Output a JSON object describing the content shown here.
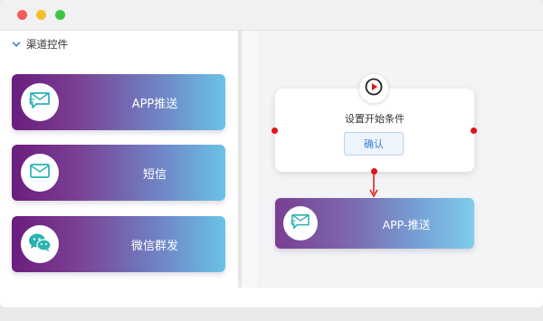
{
  "window": {
    "controls": [
      "close",
      "minimize",
      "zoom"
    ]
  },
  "sidebar": {
    "header": {
      "label": "渠道控件",
      "icon": "chevron-down-icon"
    },
    "items": [
      {
        "label": "APP推送",
        "icon": "message-send-icon"
      },
      {
        "label": "短信",
        "icon": "envelope-icon"
      },
      {
        "label": "微信群发",
        "icon": "wechat-icon"
      }
    ]
  },
  "canvas": {
    "start_node": {
      "icon": "play-icon",
      "title": "设置开始条件",
      "confirm_label": "确认"
    },
    "push_node": {
      "icon": "message-send-icon",
      "label": "APP-推送"
    }
  },
  "colors": {
    "accent_blue": "#3a7fd0",
    "port_red": "#e0141b",
    "gradient_start": "#6a1d7e",
    "gradient_end": "#6ac3e6"
  }
}
